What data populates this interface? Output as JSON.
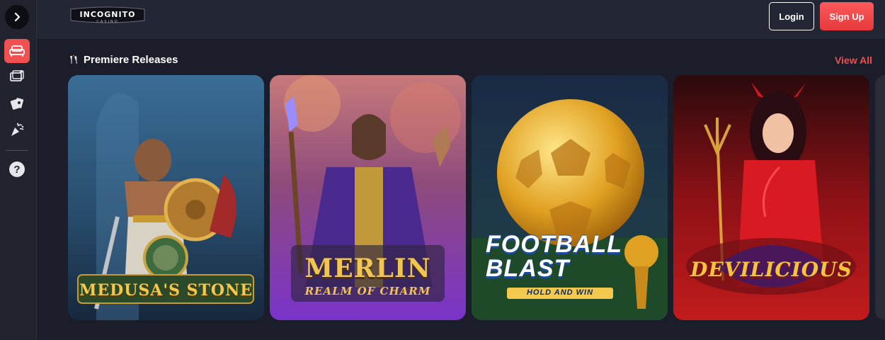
{
  "brand": {
    "logo_text": "INCOGNITO",
    "logo_sub": "CASINO"
  },
  "header": {
    "login_label": "Login",
    "signup_label": "Sign Up"
  },
  "sidebar": {
    "items": [
      {
        "icon": "sofa-icon",
        "active": true
      },
      {
        "icon": "live-tv-icon",
        "active": false
      },
      {
        "icon": "cards-icon",
        "active": false
      },
      {
        "icon": "party-popper-icon",
        "active": false
      },
      {
        "icon": "help-icon",
        "active": false
      }
    ]
  },
  "section": {
    "title": "Premiere Releases",
    "view_all": "View All"
  },
  "games": [
    {
      "title": "MEDUSA'S STONE"
    },
    {
      "title": "MERLIN",
      "subtitle": "REALM OF CHARM"
    },
    {
      "title": "FOOTBALL BLAST",
      "subtitle": "HOLD AND WIN"
    },
    {
      "title": "DEVILICIOUS"
    }
  ],
  "colors": {
    "accent": "#f0504f",
    "background": "#1b1d2b",
    "header": "#232635"
  }
}
